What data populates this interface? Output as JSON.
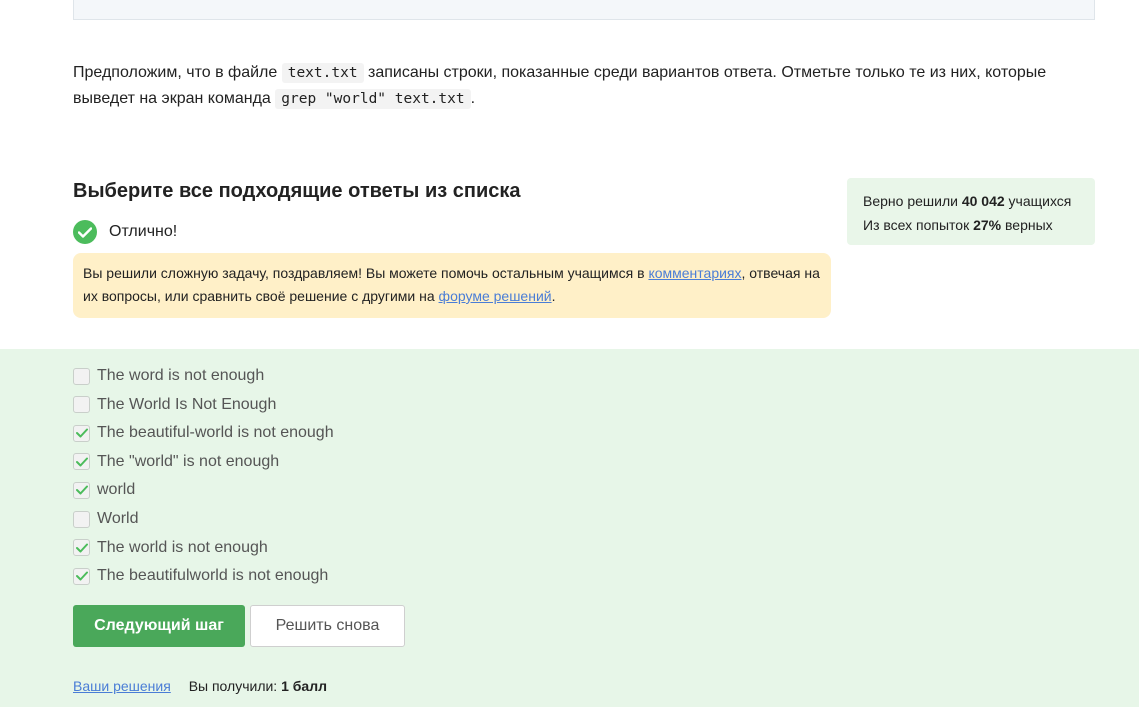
{
  "question": {
    "part1": "Предположим, что в файле",
    "code1": "text.txt",
    "part2": "записаны строки, показанные среди вариантов ответа. Отметьте только те из них, которые выведет на экран команда",
    "code2": "grep \"world\" text.txt",
    "part3": "."
  },
  "choose_title": "Выберите все подходящие ответы из списка",
  "status": {
    "text": "Отлично!",
    "icon": "check-circle-icon",
    "color": "#4cbc5c"
  },
  "stats": {
    "line1_prefix": "Верно решили",
    "solved_count": "40 042",
    "line1_suffix": "учащихся",
    "line2_prefix": "Из всех попыток",
    "percent": "27%",
    "line2_suffix": "верных"
  },
  "congrats": {
    "part1": "Вы решили сложную задачу, поздравляем! Вы можете помочь остальным учащимся в",
    "link1": "комментариях",
    "part2": ", отвечая на их вопросы, или сравнить своё решение с другими на",
    "link2": "форуме решений",
    "part3": "."
  },
  "options": [
    {
      "label": "The word is not enough",
      "checked": false
    },
    {
      "label": "The World Is Not Enough",
      "checked": false
    },
    {
      "label": "The beautiful-world is not enough",
      "checked": true
    },
    {
      "label": "The \"world\" is not enough",
      "checked": true
    },
    {
      "label": "world",
      "checked": true
    },
    {
      "label": "World",
      "checked": false
    },
    {
      "label": "The world is not enough",
      "checked": true
    },
    {
      "label": "The beautifulworld is not enough",
      "checked": true
    }
  ],
  "buttons": {
    "next": "Следующий шаг",
    "retry": "Решить снова"
  },
  "footer": {
    "solutions_link": "Ваши решения",
    "score_prefix": "Вы получили:",
    "score": "1 балл"
  },
  "colors": {
    "accent_green": "#4aa85a",
    "answer_bg": "#e7f6e8",
    "congrats_bg": "#fff0c8",
    "link": "#4a7dd6"
  }
}
